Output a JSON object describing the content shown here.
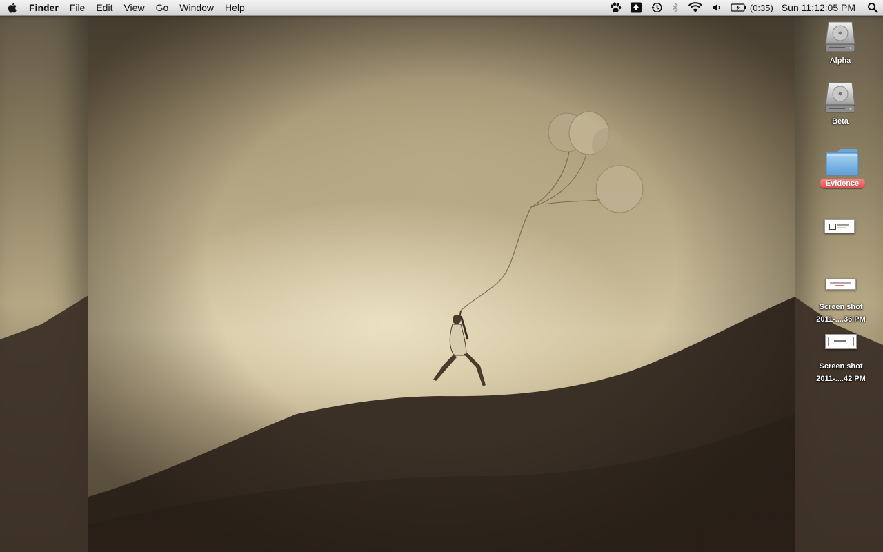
{
  "menubar": {
    "app_name": "Finder",
    "menus": [
      "File",
      "Edit",
      "View",
      "Go",
      "Window",
      "Help"
    ],
    "battery_text": "(0:35)",
    "clock": "Sun 11:12:05 PM",
    "status_icons": [
      "paw-icon",
      "upload-icon",
      "time-machine-icon",
      "bluetooth-icon",
      "wifi-icon",
      "volume-icon",
      "battery-icon",
      "spotlight-icon"
    ]
  },
  "desktop": {
    "icons": [
      {
        "label": "Alpha",
        "type": "hard-drive"
      },
      {
        "label": "Beta",
        "type": "hard-drive"
      },
      {
        "label": "Evidence",
        "type": "folder",
        "tag_color": "#e8534f"
      },
      {
        "label": "",
        "type": "screenshot"
      },
      {
        "label_line1": "Screen shot",
        "label_line2": "2011-....36 PM",
        "type": "screenshot"
      },
      {
        "label_line1": "Screen shot",
        "label_line2": "2011-....42 PM",
        "type": "screenshot"
      }
    ]
  },
  "colors": {
    "menubar": "#e6e6e6",
    "sepia_sky": "#d6c9a6",
    "hill": "#3b3026",
    "folder_blue": "#7fb6e6",
    "tag_red": "#e8534f"
  }
}
